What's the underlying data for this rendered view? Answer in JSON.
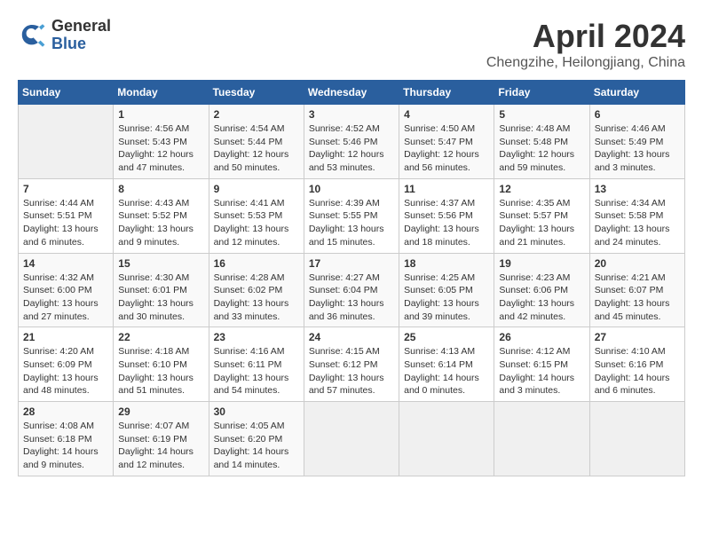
{
  "header": {
    "logo_general": "General",
    "logo_blue": "Blue",
    "title": "April 2024",
    "location": "Chengzihe, Heilongjiang, China"
  },
  "days_of_week": [
    "Sunday",
    "Monday",
    "Tuesday",
    "Wednesday",
    "Thursday",
    "Friday",
    "Saturday"
  ],
  "weeks": [
    [
      {
        "day": "",
        "info": ""
      },
      {
        "day": "1",
        "info": "Sunrise: 4:56 AM\nSunset: 5:43 PM\nDaylight: 12 hours\nand 47 minutes."
      },
      {
        "day": "2",
        "info": "Sunrise: 4:54 AM\nSunset: 5:44 PM\nDaylight: 12 hours\nand 50 minutes."
      },
      {
        "day": "3",
        "info": "Sunrise: 4:52 AM\nSunset: 5:46 PM\nDaylight: 12 hours\nand 53 minutes."
      },
      {
        "day": "4",
        "info": "Sunrise: 4:50 AM\nSunset: 5:47 PM\nDaylight: 12 hours\nand 56 minutes."
      },
      {
        "day": "5",
        "info": "Sunrise: 4:48 AM\nSunset: 5:48 PM\nDaylight: 12 hours\nand 59 minutes."
      },
      {
        "day": "6",
        "info": "Sunrise: 4:46 AM\nSunset: 5:49 PM\nDaylight: 13 hours\nand 3 minutes."
      }
    ],
    [
      {
        "day": "7",
        "info": "Sunrise: 4:44 AM\nSunset: 5:51 PM\nDaylight: 13 hours\nand 6 minutes."
      },
      {
        "day": "8",
        "info": "Sunrise: 4:43 AM\nSunset: 5:52 PM\nDaylight: 13 hours\nand 9 minutes."
      },
      {
        "day": "9",
        "info": "Sunrise: 4:41 AM\nSunset: 5:53 PM\nDaylight: 13 hours\nand 12 minutes."
      },
      {
        "day": "10",
        "info": "Sunrise: 4:39 AM\nSunset: 5:55 PM\nDaylight: 13 hours\nand 15 minutes."
      },
      {
        "day": "11",
        "info": "Sunrise: 4:37 AM\nSunset: 5:56 PM\nDaylight: 13 hours\nand 18 minutes."
      },
      {
        "day": "12",
        "info": "Sunrise: 4:35 AM\nSunset: 5:57 PM\nDaylight: 13 hours\nand 21 minutes."
      },
      {
        "day": "13",
        "info": "Sunrise: 4:34 AM\nSunset: 5:58 PM\nDaylight: 13 hours\nand 24 minutes."
      }
    ],
    [
      {
        "day": "14",
        "info": "Sunrise: 4:32 AM\nSunset: 6:00 PM\nDaylight: 13 hours\nand 27 minutes."
      },
      {
        "day": "15",
        "info": "Sunrise: 4:30 AM\nSunset: 6:01 PM\nDaylight: 13 hours\nand 30 minutes."
      },
      {
        "day": "16",
        "info": "Sunrise: 4:28 AM\nSunset: 6:02 PM\nDaylight: 13 hours\nand 33 minutes."
      },
      {
        "day": "17",
        "info": "Sunrise: 4:27 AM\nSunset: 6:04 PM\nDaylight: 13 hours\nand 36 minutes."
      },
      {
        "day": "18",
        "info": "Sunrise: 4:25 AM\nSunset: 6:05 PM\nDaylight: 13 hours\nand 39 minutes."
      },
      {
        "day": "19",
        "info": "Sunrise: 4:23 AM\nSunset: 6:06 PM\nDaylight: 13 hours\nand 42 minutes."
      },
      {
        "day": "20",
        "info": "Sunrise: 4:21 AM\nSunset: 6:07 PM\nDaylight: 13 hours\nand 45 minutes."
      }
    ],
    [
      {
        "day": "21",
        "info": "Sunrise: 4:20 AM\nSunset: 6:09 PM\nDaylight: 13 hours\nand 48 minutes."
      },
      {
        "day": "22",
        "info": "Sunrise: 4:18 AM\nSunset: 6:10 PM\nDaylight: 13 hours\nand 51 minutes."
      },
      {
        "day": "23",
        "info": "Sunrise: 4:16 AM\nSunset: 6:11 PM\nDaylight: 13 hours\nand 54 minutes."
      },
      {
        "day": "24",
        "info": "Sunrise: 4:15 AM\nSunset: 6:12 PM\nDaylight: 13 hours\nand 57 minutes."
      },
      {
        "day": "25",
        "info": "Sunrise: 4:13 AM\nSunset: 6:14 PM\nDaylight: 14 hours\nand 0 minutes."
      },
      {
        "day": "26",
        "info": "Sunrise: 4:12 AM\nSunset: 6:15 PM\nDaylight: 14 hours\nand 3 minutes."
      },
      {
        "day": "27",
        "info": "Sunrise: 4:10 AM\nSunset: 6:16 PM\nDaylight: 14 hours\nand 6 minutes."
      }
    ],
    [
      {
        "day": "28",
        "info": "Sunrise: 4:08 AM\nSunset: 6:18 PM\nDaylight: 14 hours\nand 9 minutes."
      },
      {
        "day": "29",
        "info": "Sunrise: 4:07 AM\nSunset: 6:19 PM\nDaylight: 14 hours\nand 12 minutes."
      },
      {
        "day": "30",
        "info": "Sunrise: 4:05 AM\nSunset: 6:20 PM\nDaylight: 14 hours\nand 14 minutes."
      },
      {
        "day": "",
        "info": ""
      },
      {
        "day": "",
        "info": ""
      },
      {
        "day": "",
        "info": ""
      },
      {
        "day": "",
        "info": ""
      }
    ]
  ]
}
